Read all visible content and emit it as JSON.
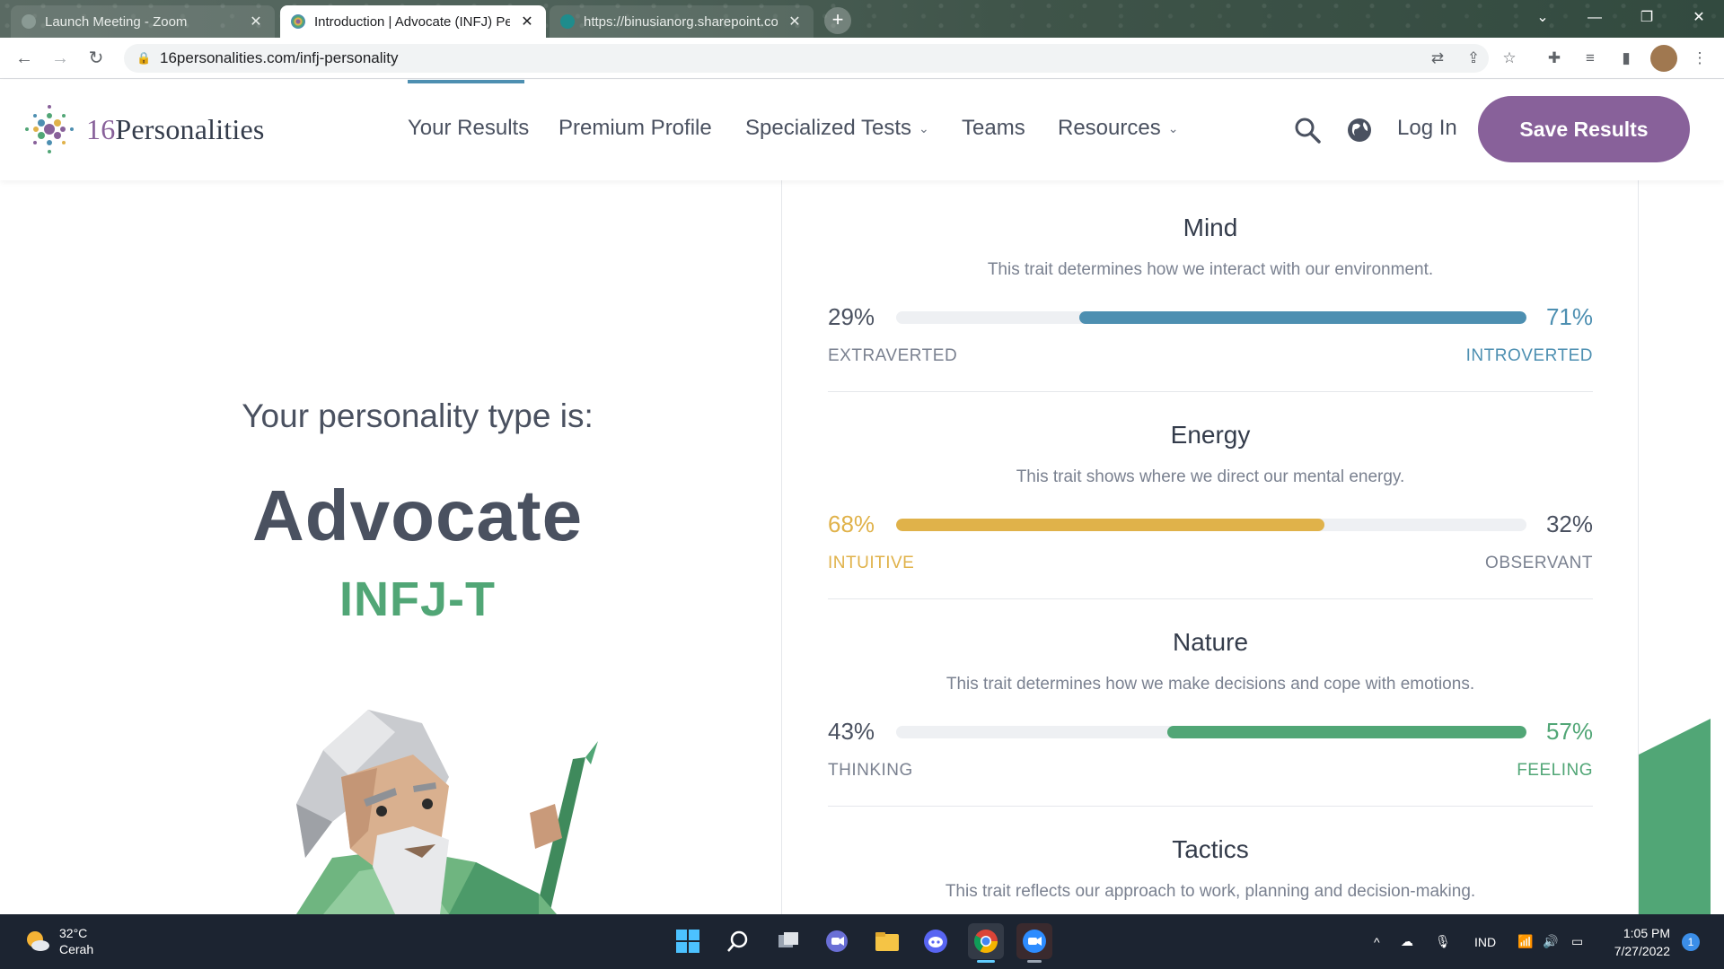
{
  "browser": {
    "tabs": [
      {
        "title": "Launch Meeting - Zoom"
      },
      {
        "title": "Introduction | Advocate (INFJ) Pe"
      },
      {
        "title": "https://binusianorg.sharepoint.co"
      }
    ],
    "new_tab": "+",
    "url": "16personalities.com/infj-personality"
  },
  "site": {
    "logo_num": "16",
    "logo_word": "Personalities",
    "nav": {
      "your_results": "Your Results",
      "premium_profile": "Premium Profile",
      "specialized_tests": "Specialized Tests",
      "teams": "Teams",
      "resources": "Resources"
    },
    "login": "Log In",
    "save": "Save Results"
  },
  "result": {
    "intro": "Your personality type is:",
    "type_name": "Advocate",
    "type_code": "INFJ-T"
  },
  "traits": [
    {
      "title": "Mind",
      "desc": "This trait determines how we interact with our environment.",
      "left_pct": "29%",
      "right_pct": "71%",
      "left_label": "EXTRAVERTED",
      "right_label": "INTROVERTED",
      "dominant": "right",
      "fill_fraction": 0.71,
      "color": "#4d8fb1"
    },
    {
      "title": "Energy",
      "desc": "This trait shows where we direct our mental energy.",
      "left_pct": "68%",
      "right_pct": "32%",
      "left_label": "INTUITIVE",
      "right_label": "OBSERVANT",
      "dominant": "left",
      "fill_fraction": 0.68,
      "color": "#e0b24a"
    },
    {
      "title": "Nature",
      "desc": "This trait determines how we make decisions and cope with emotions.",
      "left_pct": "43%",
      "right_pct": "57%",
      "left_label": "THINKING",
      "right_label": "FEELING",
      "dominant": "right",
      "fill_fraction": 0.57,
      "color": "#51a676"
    },
    {
      "title": "Tactics",
      "desc": "This trait reflects our approach to work, planning and decision-making."
    }
  ],
  "taskbar": {
    "temp": "32°C",
    "condition": "Cerah",
    "lang": "IND",
    "time": "1:05 PM",
    "date": "7/27/2022",
    "notifications": "1"
  }
}
